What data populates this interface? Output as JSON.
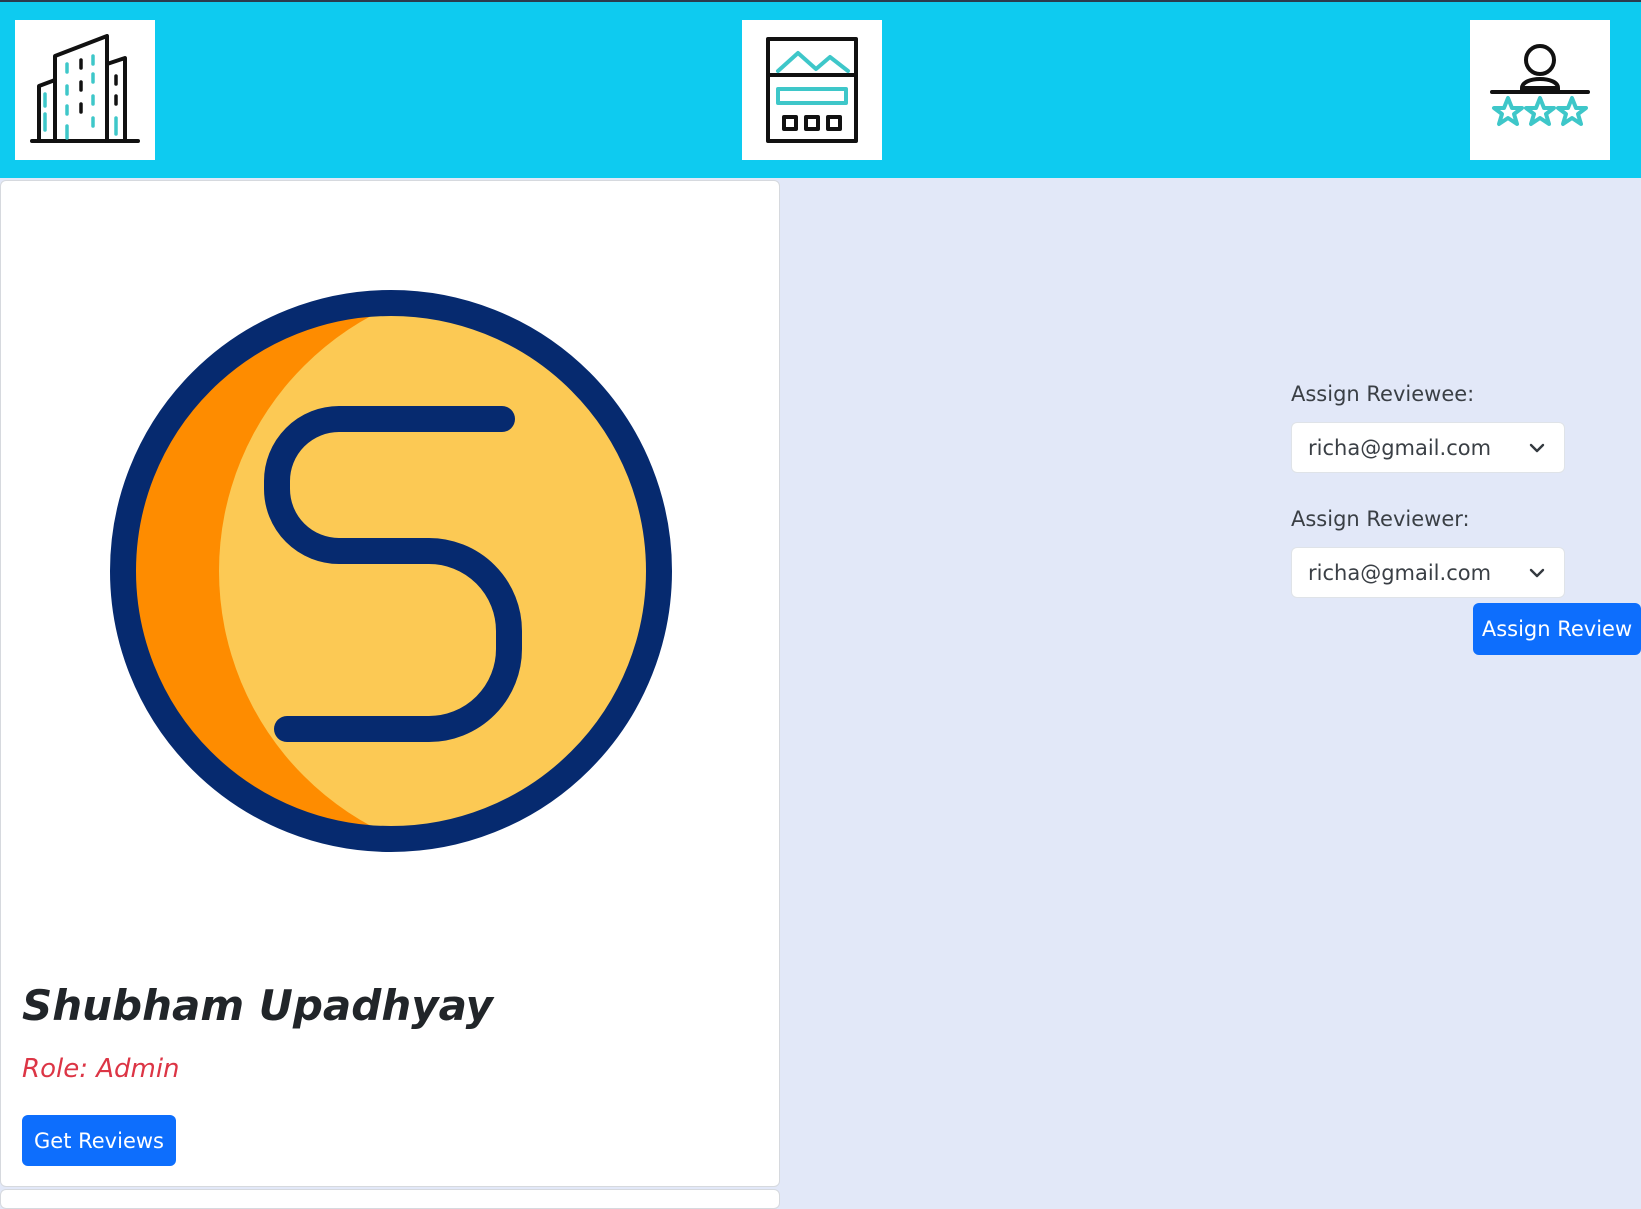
{
  "nav": {
    "items": [
      {
        "name": "building-icon"
      },
      {
        "name": "dashboard-icon"
      },
      {
        "name": "user-rating-icon"
      }
    ]
  },
  "profile": {
    "avatar_letter": "S",
    "name": "Shubham Upadhyay",
    "role": "Role: Admin",
    "get_reviews_label": "Get Reviews"
  },
  "assign": {
    "reviewee_label": "Assign Reviewee:",
    "reviewee_value": "richa@gmail.com",
    "reviewer_label": "Assign Reviewer:",
    "reviewer_value": "richa@gmail.com",
    "button_label": "Assign Review"
  },
  "colors": {
    "navbar": "#0ecbf0",
    "background": "#e2e8f8",
    "primary_button": "#0d6efd",
    "role_text": "#dc3545",
    "avatar_ring": "#062a6f",
    "avatar_fill": "#fcc954",
    "avatar_shade": "#fe8c00"
  }
}
